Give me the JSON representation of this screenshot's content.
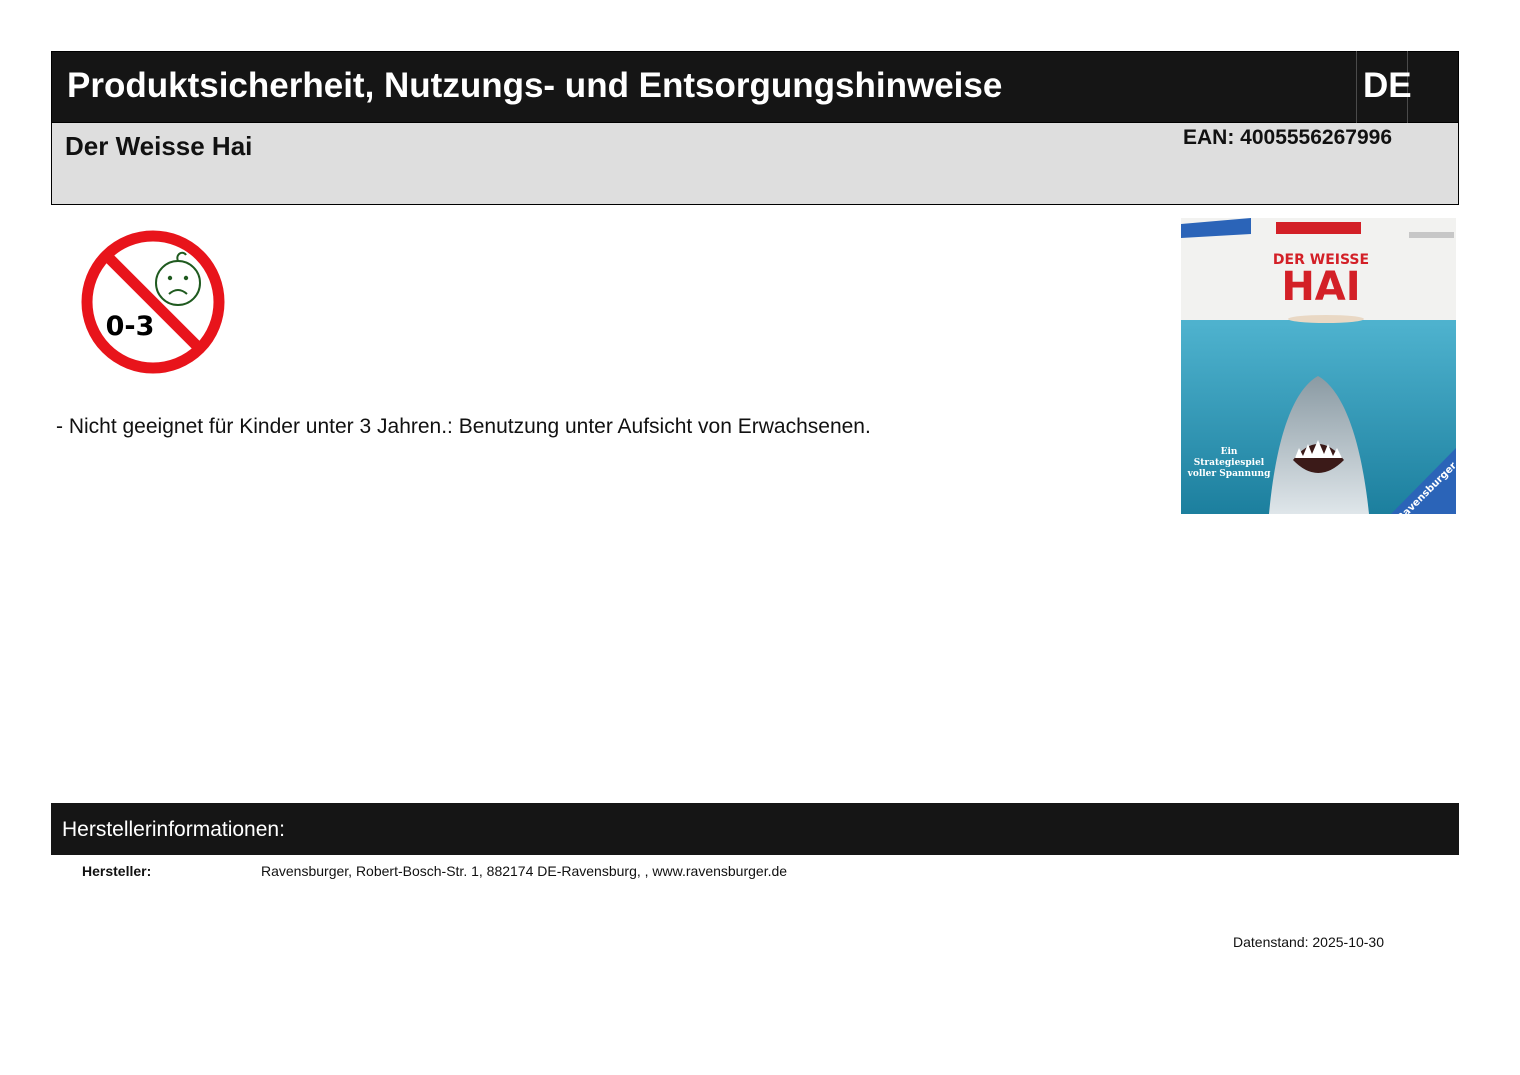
{
  "header": {
    "title": "Produktsicherheit, Nutzungs- und Entsorgungshinweise",
    "language_code": "DE"
  },
  "product": {
    "name": "Der Weisse Hai",
    "ean": "EAN: 4005556267996"
  },
  "age_warning": {
    "icon": "no-children-0-3-icon",
    "age_label": "0-3",
    "text": "- Nicht geeignet für Kinder unter 3 Jahren.: Benutzung unter Aufsicht von Erwachsenen."
  },
  "product_image": {
    "title_line1": "DER WEISSE",
    "title_line2": "HAI",
    "tagline": [
      "Ein",
      "Strategiespiel",
      "voller Spannung"
    ],
    "brand": "Ravensburger"
  },
  "manufacturer": {
    "heading": "Herstellerinformationen:",
    "label": "Hersteller:",
    "value": "Ravensburger, Robert-Bosch-Str. 1, 882174 DE-Ravensburg, , www.ravensburger.de"
  },
  "footer": {
    "date": "Datenstand: 2025-10-30"
  },
  "colors": {
    "header_bg": "#151515",
    "product_bar_bg": "#dedede",
    "prohibition_red": "#e8141b",
    "face_green": "#1f5a1f"
  }
}
